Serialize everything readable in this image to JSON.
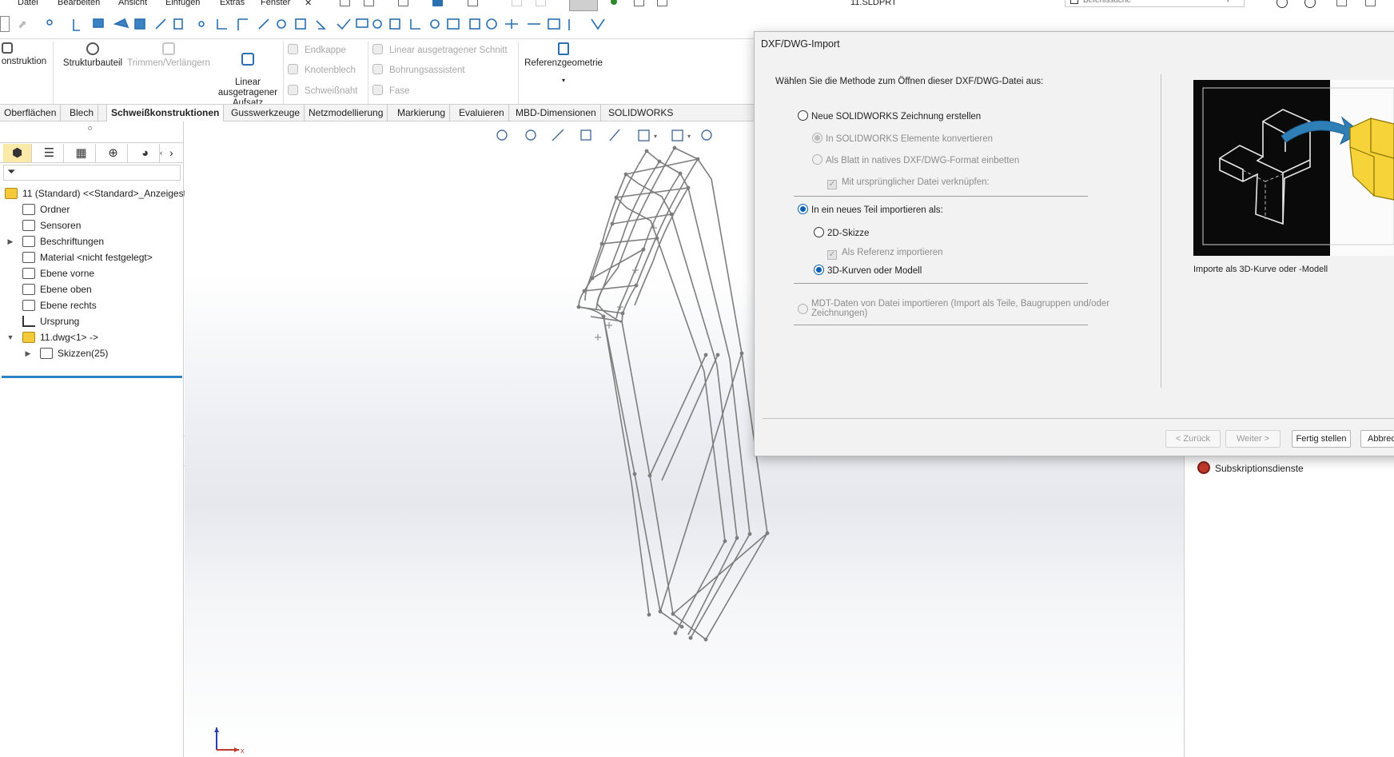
{
  "app": {
    "title": "11.SLDPRT"
  },
  "menu": {
    "items": [
      "Datei",
      "Bearbeiten",
      "Ansicht",
      "Einfügen",
      "Extras",
      "Fenster"
    ]
  },
  "search": {
    "placeholder": "Befehlssuche"
  },
  "ribbon": {
    "konstruktion": "onstruktion",
    "strukturbauteil": "Strukturbauteil",
    "trimmen": "Trimmen/Verlängern",
    "linear_aufsatz": "Linear\nausgetragener\nAufsatz",
    "endkappe": "Endkappe",
    "knotenblech": "Knotenblech",
    "schweissnaht": "Schweißnaht",
    "linear_schnitt": "Linear ausgetragener Schnitt",
    "bohrungsassistent": "Bohrungsassistent",
    "fase": "Fase",
    "referenzgeometrie": "Referenzgeometrie"
  },
  "tabs": [
    "Oberflächen",
    "Blech",
    "Schweißkonstruktionen",
    "Gusswerkzeuge",
    "Netzmodellierung",
    "Markierung",
    "Evaluieren",
    "MBD-Dimensionen",
    "SOLIDWORKS Zusatzanwendungen"
  ],
  "active_tab": "Schweißkonstruktionen",
  "tree": {
    "root": "11 (Standard) <<Standard>_Anzeigest",
    "nodes": [
      "Ordner",
      "Sensoren",
      "Beschriftungen",
      "Material <nicht festgelegt>",
      "Ebene vorne",
      "Ebene oben",
      "Ebene rechts",
      "Ursprung",
      "11.dwg<1> ->"
    ],
    "child": "Skizzen(25)"
  },
  "dialog": {
    "title": "DXF/DWG-Import",
    "question": "Wählen Sie die Methode zum Öffnen dieser  DXF/DWG-Datei aus:",
    "opt_new_drawing": "Neue SOLIDWORKS Zeichnung erstellen",
    "opt_convert": "In SOLIDWORKS Elemente konvertieren",
    "opt_embed": "Als Blatt in natives DXF/DWG-Format einbetten",
    "chk_link": "Mit ursprünglicher Datei verknüpfen:",
    "opt_import_part": "In ein neues Teil importieren als:",
    "opt_2d": "2D-Skizze",
    "chk_ref": "Als Referenz importieren",
    "opt_3d": "3D-Kurven oder Modell",
    "opt_mdt": "MDT-Daten von Datei importieren (Import als Teile, Baugruppen und/oder\nZeichnungen)",
    "preview_caption": "Importe als 3D-Kurve oder -Modell",
    "btn_back": "< Zurück",
    "btn_next": "Weiter >",
    "btn_finish": "Fertig stellen",
    "btn_cancel": "Abbrec"
  },
  "taskpane": {
    "subscription": "Subskriptionsdienste"
  },
  "triad": {
    "x": "x"
  },
  "colors": {
    "accent": "#0a5fb4",
    "tree_line": "#2a84c6",
    "active_fm_tab": "#fbe9a8"
  }
}
